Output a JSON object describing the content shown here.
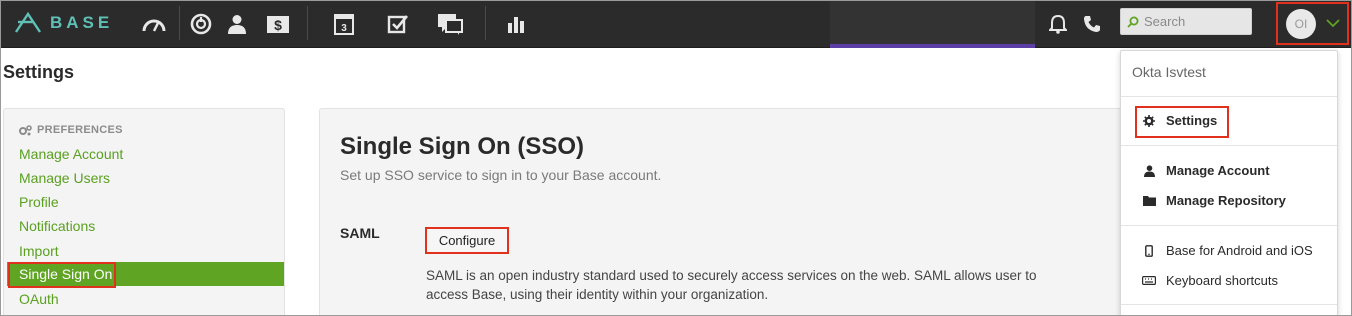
{
  "app": {
    "logo_text": "BASE",
    "brand_color": "#5fc0b6",
    "accent_green": "#5fa423",
    "highlight_red": "#e0301e"
  },
  "topbar": {
    "icons": [
      "dashboard-icon",
      "power-icon",
      "user-icon",
      "dollar-icon",
      "calendar-icon",
      "checkbox-icon",
      "messages-icon",
      "chart-icon",
      "bell-icon",
      "phone-icon"
    ],
    "calendar_day": "3",
    "search_placeholder": "Search",
    "avatar_initials": "OI"
  },
  "page": {
    "title": "Settings"
  },
  "sidebar": {
    "section_label": "PREFERENCES",
    "items": [
      {
        "label": "Manage Account"
      },
      {
        "label": "Manage Users"
      },
      {
        "label": "Profile"
      },
      {
        "label": "Notifications"
      },
      {
        "label": "Import"
      },
      {
        "label": "Single Sign On",
        "active": true
      },
      {
        "label": "OAuth"
      }
    ]
  },
  "main": {
    "title": "Single Sign On (SSO)",
    "subtitle": "Set up SSO service to sign in to your Base account.",
    "saml_label": "SAML",
    "configure_label": "Configure",
    "saml_description": "SAML is an open industry standard used to securely access services on the web. SAML allows user to access Base, using their identity within your organization."
  },
  "dropdown": {
    "user_name": "Okta Isvtest",
    "items": [
      {
        "label": "Settings",
        "icon": "gear-icon"
      },
      {
        "label": "Manage Account",
        "icon": "user-icon"
      },
      {
        "label": "Manage Repository",
        "icon": "folder-icon"
      },
      {
        "label": "Base for Android and iOS",
        "icon": "mobile-icon"
      },
      {
        "label": "Keyboard shortcuts",
        "icon": "keyboard-icon"
      }
    ]
  }
}
